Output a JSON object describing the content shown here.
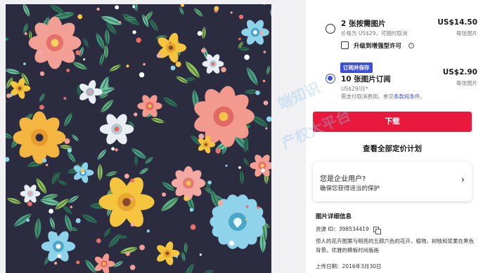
{
  "pricing": {
    "option1": {
      "title": "2 张按需图片",
      "subtitle": "价格为 US$29，可随时取消",
      "price": "US$14.50",
      "unit": "每张图片",
      "upgrade_label": "升级到增强型许可",
      "info_icon_glyph": "i"
    },
    "option2": {
      "badge": "订阅并保存",
      "title": "10 张图片订阅",
      "subtitle": "US$29/月*",
      "note_prefix": "需支付取消费用。参见",
      "note_link": "条款和条件",
      "note_suffix": "。",
      "price": "US$2.90",
      "unit": "每张图片"
    }
  },
  "actions": {
    "download_label": "下载",
    "all_pricing_label": "查看全部定价计划"
  },
  "enterprise": {
    "title": "您是企业用户?",
    "subtitle": "确保您获得适当的保护",
    "chevron": "›"
  },
  "details": {
    "title": "图片详细信息",
    "asset_id_label": "资源 ID：",
    "asset_id": "398534419",
    "description": "惊人的花卉图案与明亮的五颜六色的花卉，植物，树枝和浆果在黑色背景。优雅的模板时尚版画",
    "upload_date": "上传日期：2016年3月30日"
  },
  "watermark": {
    "line1": "端知识",
    "line2": "产权大平台"
  },
  "colors": {
    "accent_blue": "#3d4fd6",
    "download_red": "#e8193c",
    "artwork_bg": "#2b2c3f"
  }
}
